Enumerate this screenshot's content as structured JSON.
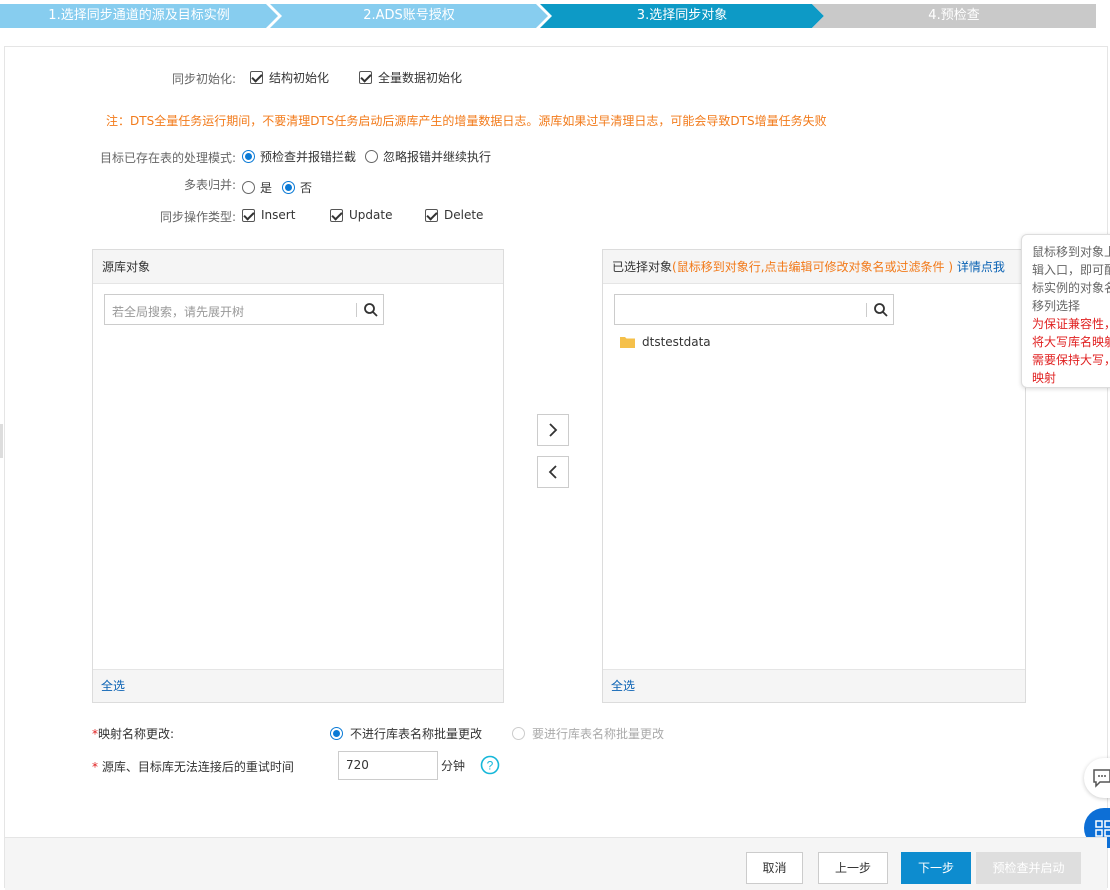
{
  "steps": [
    {
      "label": "1.选择同步通道的源及目标实例",
      "state": "done"
    },
    {
      "label": "2.ADS账号授权",
      "state": "done"
    },
    {
      "label": "3.选择同步对象",
      "state": "active"
    },
    {
      "label": "4.预检查",
      "state": "todo"
    }
  ],
  "colors": {
    "done": "#87cdef",
    "active": "#0d9ac6",
    "todo": "#c9c9c9",
    "link": "#0a62b4",
    "warn": "#f27a1a",
    "primary": "#0d8ccf"
  },
  "sync_init": {
    "label": "同步初始化:",
    "options": [
      {
        "label": "结构初始化",
        "checked": true
      },
      {
        "label": "全量数据初始化",
        "checked": true
      }
    ]
  },
  "note": "注：DTS全量任务运行期间，不要清理DTS任务启动后源库产生的增量数据日志。源库如果过早清理日志，可能会导致DTS增量任务失败",
  "existing_table_mode": {
    "label": "目标已存在表的处理模式:",
    "options": [
      {
        "label": "预检查并报错拦截",
        "selected": true
      },
      {
        "label": "忽略报错并继续执行",
        "selected": false
      }
    ]
  },
  "multi_table_merge": {
    "label": "多表归并:",
    "options": [
      {
        "label": "是",
        "selected": false
      },
      {
        "label": "否",
        "selected": true
      }
    ]
  },
  "sync_ops": {
    "label": "同步操作类型:",
    "options": [
      {
        "label": "Insert",
        "checked": true
      },
      {
        "label": "Update",
        "checked": true
      },
      {
        "label": "Delete",
        "checked": true
      }
    ]
  },
  "source_panel": {
    "title": "源库对象",
    "search_placeholder": "若全局搜索，请先展开树",
    "select_all": "全选"
  },
  "selected_panel": {
    "title": "已选择对象",
    "hint": "(鼠标移到对象行,点击编辑可修改对象名或过滤条件 )",
    "detail_link": "详情点我",
    "search_placeholder": "",
    "items": [
      {
        "name": "dtstestdata",
        "icon": "folder-icon"
      }
    ],
    "select_all": "全选"
  },
  "tooltip": {
    "lines": [
      "鼠标移到对象上",
      "辑入口，即可配",
      "标实例的对象名",
      "移列选择"
    ],
    "warn_lines": [
      "为保证兼容性，",
      "将大写库名映射",
      "需要保持大写，",
      "映射"
    ]
  },
  "mapping_change": {
    "label": "映射名称更改:",
    "options": [
      {
        "label": "不进行库表名称批量更改",
        "selected": true,
        "disabled": false
      },
      {
        "label": "要进行库表名称批量更改",
        "selected": false,
        "disabled": true
      }
    ]
  },
  "retry_time": {
    "label": "源库、目标库无法连接后的重试时间",
    "value": "720",
    "unit": "分钟"
  },
  "footer": {
    "cancel": "取消",
    "prev": "上一步",
    "next": "下一步",
    "precheck": "预检查并启动"
  }
}
